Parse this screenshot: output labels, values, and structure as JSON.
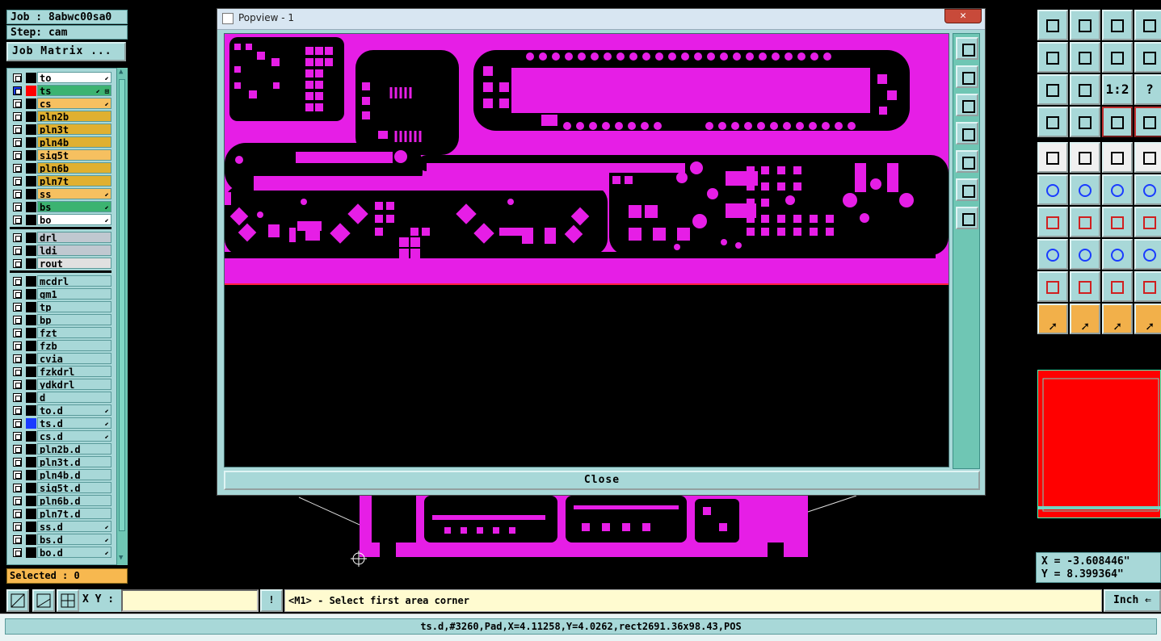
{
  "job": {
    "label": "Job : 8abwc00sa0",
    "step": "Step: cam",
    "matrix_button": "Job Matrix ..."
  },
  "layers_group1": [
    {
      "name": "to",
      "color": "#ffffff",
      "swatch": "",
      "icon": "⬋"
    },
    {
      "name": "ts",
      "color": "#3cb371",
      "swatch": "#ff0000",
      "icon": "⬋ ⊞",
      "active": true
    },
    {
      "name": "cs",
      "color": "#f6c060",
      "swatch": "",
      "icon": "⬋"
    },
    {
      "name": "pln2b",
      "color": "#e0b030",
      "swatch": "",
      "icon": ""
    },
    {
      "name": "pln3t",
      "color": "#e0b030",
      "swatch": "",
      "icon": ""
    },
    {
      "name": "pln4b",
      "color": "#e0b030",
      "swatch": "",
      "icon": ""
    },
    {
      "name": "sig5t",
      "color": "#f6c060",
      "swatch": "",
      "icon": ""
    },
    {
      "name": "pln6b",
      "color": "#e0b030",
      "swatch": "",
      "icon": ""
    },
    {
      "name": "pln7t",
      "color": "#e0b030",
      "swatch": "",
      "icon": ""
    },
    {
      "name": "ss",
      "color": "#f6c060",
      "swatch": "",
      "icon": "⬋"
    },
    {
      "name": "bs",
      "color": "#3cb371",
      "swatch": "",
      "icon": "⬋"
    },
    {
      "name": "bo",
      "color": "#ffffff",
      "swatch": "",
      "icon": "⬋"
    }
  ],
  "layers_group2": [
    {
      "name": "drl",
      "color": "#c0c8d0",
      "swatch": "",
      "icon": ""
    },
    {
      "name": "ldi",
      "color": "#c0c8d0",
      "swatch": "",
      "icon": ""
    },
    {
      "name": "rout",
      "color": "#e0e0e0",
      "swatch": "",
      "icon": ""
    }
  ],
  "layers_group3": [
    {
      "name": "mcdrl",
      "color": "#a8d8d8",
      "swatch": "",
      "icon": ""
    },
    {
      "name": "gm1",
      "color": "#a8d8d8",
      "swatch": "",
      "icon": ""
    },
    {
      "name": "tp",
      "color": "#a8d8d8",
      "swatch": "",
      "icon": ""
    },
    {
      "name": "bp",
      "color": "#a8d8d8",
      "swatch": "",
      "icon": ""
    },
    {
      "name": "fzt",
      "color": "#a8d8d8",
      "swatch": "",
      "icon": ""
    },
    {
      "name": "fzb",
      "color": "#a8d8d8",
      "swatch": "",
      "icon": ""
    },
    {
      "name": "cvia",
      "color": "#a8d8d8",
      "swatch": "",
      "icon": ""
    },
    {
      "name": "fzkdrl",
      "color": "#a8d8d8",
      "swatch": "",
      "icon": ""
    },
    {
      "name": "ydkdrl",
      "color": "#a8d8d8",
      "swatch": "",
      "icon": ""
    },
    {
      "name": "d",
      "color": "#a8d8d8",
      "swatch": "",
      "icon": ""
    },
    {
      "name": "to.d",
      "color": "#a8d8d8",
      "swatch": "",
      "icon": "⬋"
    },
    {
      "name": "ts.d",
      "color": "#a8d8d8",
      "swatch": "#1a3cff",
      "icon": "⬋"
    },
    {
      "name": "cs.d",
      "color": "#a8d8d8",
      "swatch": "",
      "icon": "⬋"
    },
    {
      "name": "pln2b.d",
      "color": "#a8d8d8",
      "swatch": "",
      "icon": ""
    },
    {
      "name": "pln3t.d",
      "color": "#a8d8d8",
      "swatch": "",
      "icon": ""
    },
    {
      "name": "pln4b.d",
      "color": "#a8d8d8",
      "swatch": "",
      "icon": ""
    },
    {
      "name": "sig5t.d",
      "color": "#a8d8d8",
      "swatch": "",
      "icon": ""
    },
    {
      "name": "pln6b.d",
      "color": "#a8d8d8",
      "swatch": "",
      "icon": ""
    },
    {
      "name": "pln7t.d",
      "color": "#a8d8d8",
      "swatch": "",
      "icon": ""
    },
    {
      "name": "ss.d",
      "color": "#a8d8d8",
      "swatch": "",
      "icon": "⬋"
    },
    {
      "name": "bs.d",
      "color": "#a8d8d8",
      "swatch": "",
      "icon": "⬋"
    },
    {
      "name": "bo.d",
      "color": "#a8d8d8",
      "swatch": "",
      "icon": "⬋"
    }
  ],
  "selected": "Selected : 0",
  "popup": {
    "title": "Popview - 1",
    "close_x": "✕",
    "close_button": "Close"
  },
  "popup_side_icons": [
    "zoom-fit-icon",
    "pan-up-icon",
    "pan-down-icon",
    "pan-left-icon",
    "pan-right-icon",
    "zoom-in-icon",
    "zoom-out-icon"
  ],
  "toolbar": [
    [
      "layer-up",
      "layer-down",
      "home",
      "split-view"
    ],
    [
      "pan-left",
      "pan-right",
      "flip-horizontal",
      "snake"
    ],
    [
      "zoom-fit",
      "zoom-center",
      "1:2",
      "?"
    ],
    [
      "measure-probe",
      "net-probe",
      "net-connect",
      "net-compare"
    ],
    [
      "drill-point",
      "select-box",
      "ruler",
      "pad-round"
    ],
    [
      "node-connect",
      "node-cross",
      "add-vertex",
      "move-vertex"
    ],
    [
      "angle-line",
      "slope-line",
      "arc-rotate",
      "text-edit"
    ],
    [
      "pad-select",
      "line-select",
      "bracket-select",
      "cluster-select"
    ],
    [
      "delta-edit",
      "triangle-edit",
      "arch-edit",
      "arch-up"
    ],
    [
      "pointer",
      "pointer-box",
      "pointer-circle",
      "route-step"
    ]
  ],
  "toolbar_glyphs": {
    "1:2": "1:2",
    "?": "?"
  },
  "coords": {
    "x": "X = -3.608446\"",
    "y": "Y = 8.399364\""
  },
  "bottom": {
    "xy_label": "X Y :",
    "xy_value": "",
    "info_button": "!",
    "prompt": "<M1> - Select first area corner",
    "unit": "Inch ⇐"
  },
  "status": "ts.d,#3260,Pad,X=4.11258,Y=4.0262,rect2691.36x98.43,POS",
  "colors": {
    "panel": "#a8d8d8",
    "pcb": "#e61ee6",
    "copper_bg": "#000000",
    "accent_orange": "#f2b04a",
    "preview_red": "#ff0000"
  }
}
